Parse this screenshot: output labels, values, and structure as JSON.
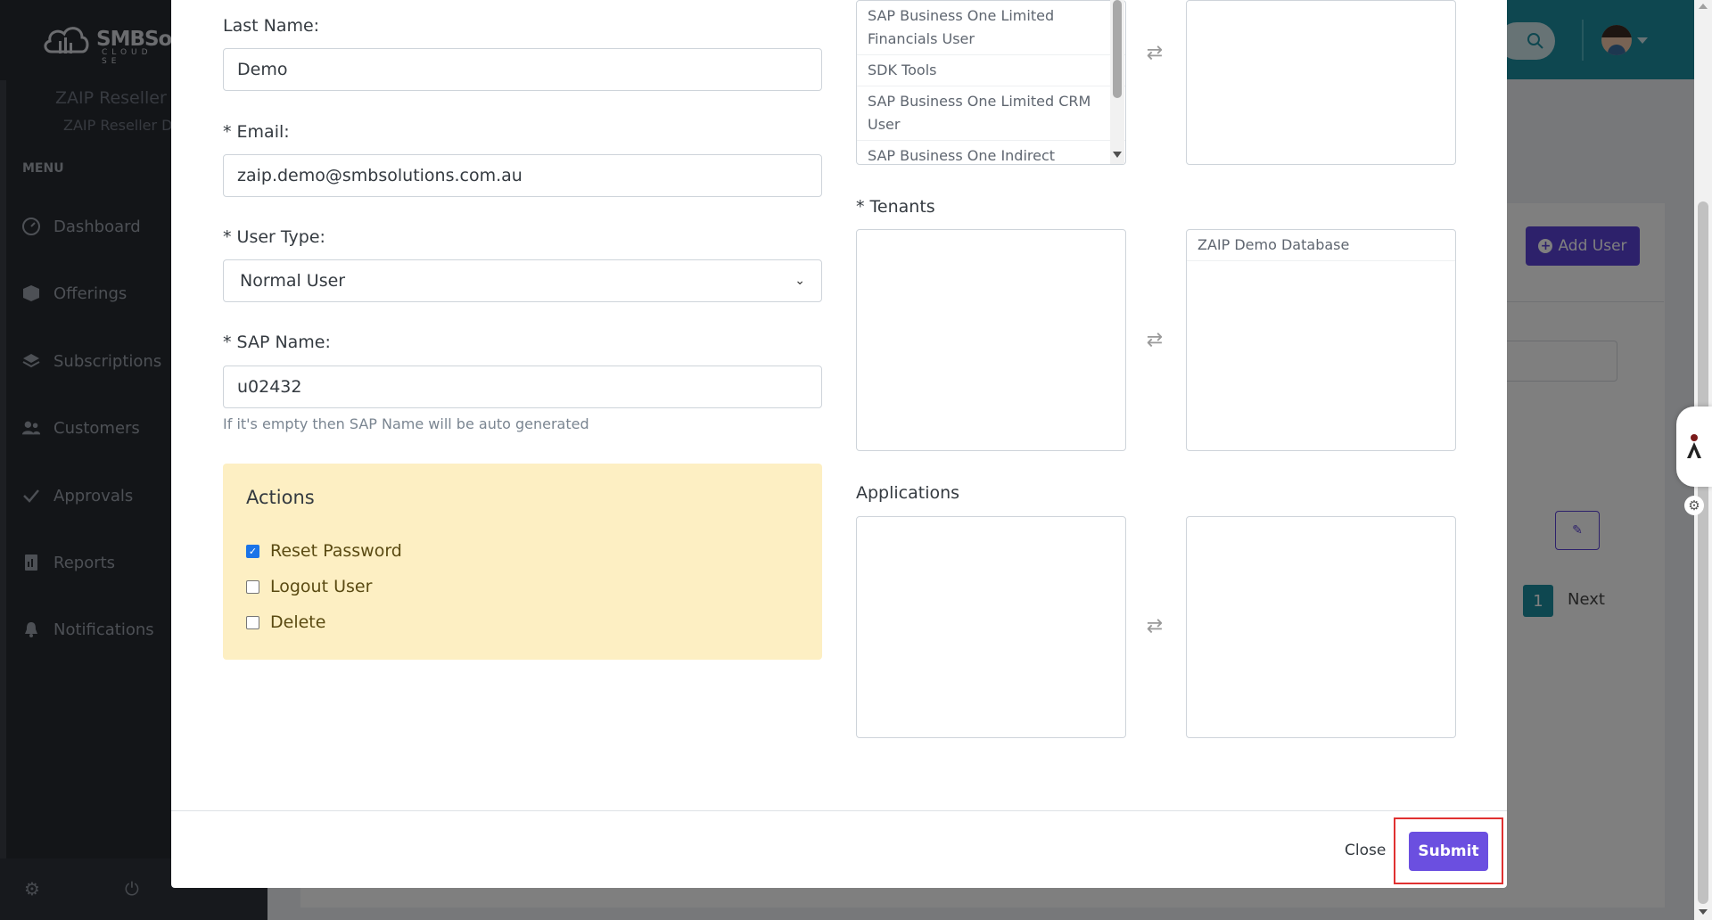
{
  "app": {
    "logo_text": "SMBSol",
    "logo_sub": "CLOUD SE",
    "reseller_name": "ZAIP Reseller D",
    "reseller_sub": "ZAIP Reseller D"
  },
  "sidebar": {
    "menu_label": "MENU",
    "items": [
      {
        "label": "Dashboard",
        "icon": "dashboard-icon"
      },
      {
        "label": "Offerings",
        "icon": "box-icon"
      },
      {
        "label": "Subscriptions",
        "icon": "layers-icon"
      },
      {
        "label": "Customers",
        "icon": "users-icon"
      },
      {
        "label": "Approvals",
        "icon": "check-icon"
      },
      {
        "label": "Reports",
        "icon": "report-icon"
      },
      {
        "label": "Notifications",
        "icon": "bell-icon"
      }
    ]
  },
  "background": {
    "add_user_label": "Add User",
    "page_number": "1",
    "next_label": "Next"
  },
  "form": {
    "last_name_label": "Last Name:",
    "last_name_value": "Demo",
    "email_label": "* Email:",
    "email_value": "zaip.demo@smbsolutions.com.au",
    "user_type_label": "* User Type:",
    "user_type_value": "Normal User",
    "sap_name_label": "* SAP Name:",
    "sap_name_value": "u02432",
    "sap_name_hint": "If it's empty then SAP Name will be auto generated"
  },
  "actions": {
    "title": "Actions",
    "reset_password": "Reset Password",
    "reset_password_checked": true,
    "logout_user": "Logout User",
    "logout_user_checked": false,
    "delete": "Delete",
    "delete_checked": false
  },
  "licenses": {
    "available": [
      "SAP Business One Limited Financials User",
      "SDK Tools",
      "SAP Business One Limited CRM User",
      "SAP Business One Indirect"
    ]
  },
  "tenants": {
    "label": "* Tenants",
    "selected": [
      "ZAIP Demo Database"
    ]
  },
  "applications": {
    "label": "Applications"
  },
  "footer": {
    "close_label": "Close",
    "submit_label": "Submit"
  },
  "colors": {
    "accent": "#6b4fe0",
    "teal": "#1d8fa0",
    "highlight": "#e03131",
    "actions_bg": "#fdefc3"
  }
}
